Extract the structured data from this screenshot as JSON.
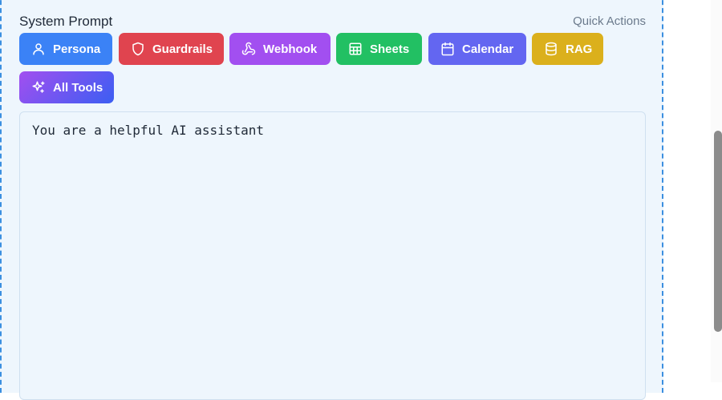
{
  "header": {
    "title": "System Prompt",
    "quick_actions": "Quick Actions"
  },
  "buttons": [
    {
      "label": "Persona",
      "icon": "user-icon",
      "color": "#3b82f6"
    },
    {
      "label": "Guardrails",
      "icon": "shield-icon",
      "color": "#e0444f"
    },
    {
      "label": "Webhook",
      "icon": "webhook-icon",
      "color": "#a24ff0"
    },
    {
      "label": "Sheets",
      "icon": "table-icon",
      "color": "#22c063"
    },
    {
      "label": "Calendar",
      "icon": "calendar-icon",
      "color": "#6366f1"
    },
    {
      "label": "RAG",
      "icon": "database-icon",
      "color": "#dbb01c"
    },
    {
      "label": "All Tools",
      "icon": "sparkles-icon",
      "color": "#7c55f2"
    }
  ],
  "editor": {
    "value": "You are a helpful AI assistant"
  }
}
